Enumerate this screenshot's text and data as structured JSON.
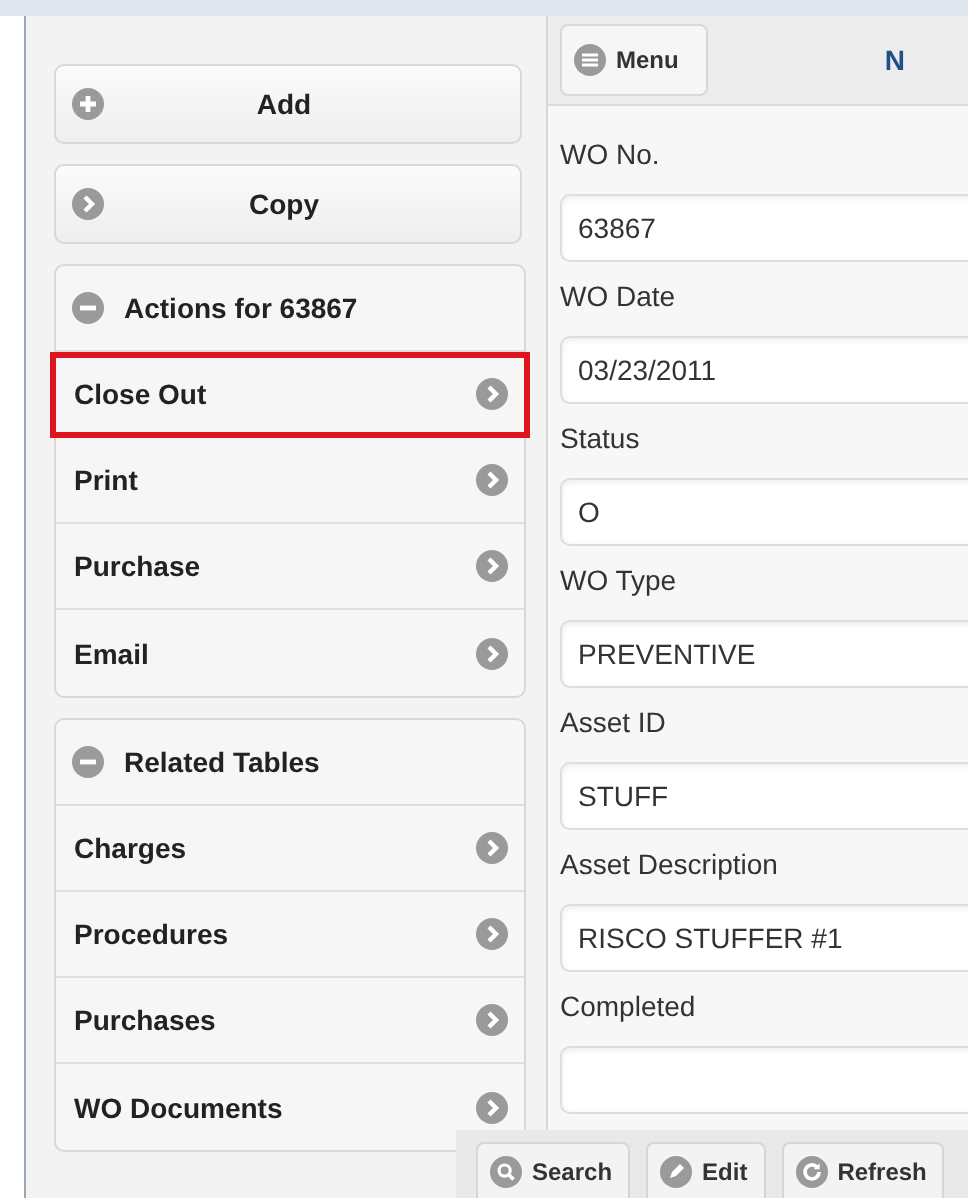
{
  "sidebar": {
    "buttons": [
      {
        "label": "Add"
      },
      {
        "label": "Copy"
      }
    ],
    "groups": [
      {
        "title": "Actions for 63867",
        "expanded": true,
        "items": [
          {
            "label": "Close Out",
            "highlighted": true
          },
          {
            "label": "Print",
            "highlighted": false
          },
          {
            "label": "Purchase",
            "highlighted": false
          },
          {
            "label": "Email",
            "highlighted": false
          }
        ]
      },
      {
        "title": "Related Tables",
        "expanded": true,
        "items": [
          {
            "label": "Charges",
            "highlighted": false
          },
          {
            "label": "Procedures",
            "highlighted": false
          },
          {
            "label": "Purchases",
            "highlighted": false
          },
          {
            "label": "WO Documents",
            "highlighted": false
          }
        ]
      }
    ]
  },
  "header": {
    "menu_button": "Menu",
    "title": "N"
  },
  "form": {
    "fields": [
      {
        "label": "WO No.",
        "value": "63867"
      },
      {
        "label": "WO Date",
        "value": "03/23/2011"
      },
      {
        "label": "Status",
        "value": "O"
      },
      {
        "label": "WO Type",
        "value": "PREVENTIVE"
      },
      {
        "label": "Asset ID",
        "value": "STUFF"
      },
      {
        "label": "Asset Description",
        "value": "RISCO STUFFER #1"
      },
      {
        "label": "Completed"
      }
    ]
  },
  "toolbar": [
    {
      "label": "Search"
    },
    {
      "label": "Edit"
    },
    {
      "label": "Refresh"
    }
  ]
}
